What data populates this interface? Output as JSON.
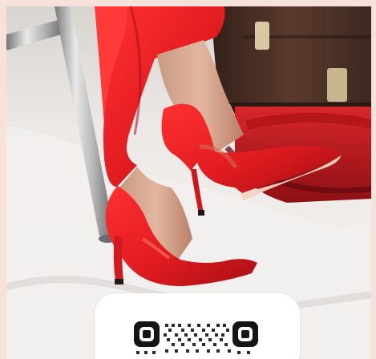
{
  "scene": {
    "subject": "red-pointed-stiletto-pumps",
    "props": [
      "chrome-chair-leg",
      "vintage-suitcase",
      "red-suitcase"
    ],
    "colors": {
      "pink_border": "#f7e2db",
      "floor_cloth": "#f0eeec",
      "red_shoe": "#e21e23",
      "dark_suitcase": "#4c2f25"
    }
  },
  "qr_card": {
    "icon": "qr-code-icon"
  }
}
